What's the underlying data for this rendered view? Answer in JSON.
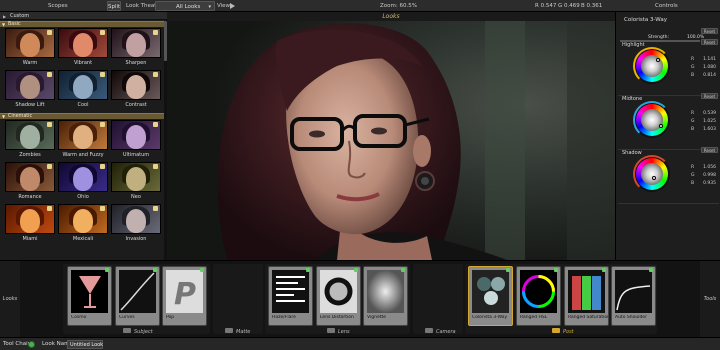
{
  "top_bar": {
    "scopes_label": "Scopes",
    "split_button": "Split",
    "theater_label": "Look Theater",
    "theater_select": "All Looks",
    "view_label": "View",
    "zoom_text": "Zoom: 60.5%",
    "r_readout": "R 0.547",
    "g_readout": "G 0.469",
    "b_readout": "B 0.361",
    "controls_label": "Controls"
  },
  "left_panel": {
    "header": "Custom",
    "sections": [
      {
        "label": "Basic",
        "items": [
          "Warm",
          "Vibrant",
          "Sharpen",
          "Shadow Lift",
          "Cool",
          "Contrast"
        ]
      },
      {
        "label": "Cinematic",
        "items": [
          "Zombies",
          "Warm and Fuzzy",
          "Ultimatum",
          "Romance",
          "Ohio",
          "Neo",
          "Miami",
          "Mexicali",
          "Invasion"
        ]
      }
    ]
  },
  "viewer": {
    "title": "Looks"
  },
  "controls": {
    "title": "Colorista 3-Way",
    "strength_label": "Strength:",
    "strength_value": "100.0%",
    "reset_label": "Reset",
    "wheels": [
      {
        "label": "Highlight",
        "r": "1.141",
        "g": "1.080",
        "b": "0.814",
        "accent": "#e8b400"
      },
      {
        "label": "Midtone",
        "r": "0.539",
        "g": "1.025",
        "b": "1.603",
        "accent": "#2aa6d8"
      },
      {
        "label": "Shadow",
        "r": "1.056",
        "g": "0.998",
        "b": "0.935",
        "accent": "#d04a2c"
      }
    ]
  },
  "bottom": {
    "left_label": "Looks",
    "right_label": "Tools",
    "tools": [
      {
        "name": "Cosmo"
      },
      {
        "name": "Curves"
      },
      {
        "name": "Pop"
      },
      {
        "name": "Haze/Flare"
      },
      {
        "name": "Lens Distortion"
      },
      {
        "name": "Vignette"
      },
      {
        "name": "Colorista 3-Way"
      },
      {
        "name": "Ranged HSL"
      },
      {
        "name": "Ranged Saturation"
      },
      {
        "name": "Auto Shoulder"
      }
    ],
    "groups": [
      "Subject",
      "Matte",
      "Lens",
      "Camera",
      "Post"
    ]
  },
  "status_bar": {
    "tool_chain_label": "Tool Chain:",
    "look_name_label": "Look Name:",
    "look_name_value": "Untitled Look"
  }
}
